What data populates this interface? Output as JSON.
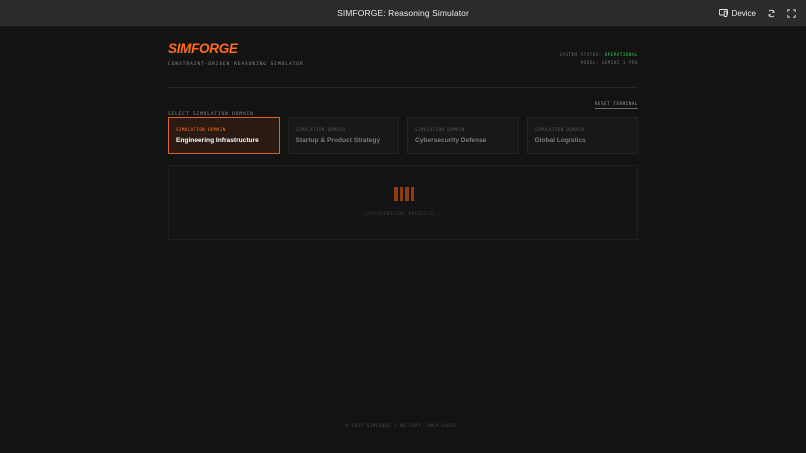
{
  "topbar": {
    "title": "SIMFORGE: Reasoning Simulator",
    "device_label": "Device",
    "icons": [
      "device-icon",
      "rotate-icon",
      "fullscreen-icon"
    ]
  },
  "header": {
    "brand": "SIMFORGE",
    "subtitle": "CONSTRAINT-DRIVEN REASONING SIMULATOR",
    "status_label": "SYSTEM STATUS:",
    "status_value": "OPERATIONAL",
    "model_label": "MODEL: GEMINI 3 PRO"
  },
  "domain_select": {
    "label": "SELECT SIMULATION DOMAIN",
    "reset_label": "RESET TERMINAL"
  },
  "cards": [
    {
      "kicker": "SIMULATION DOMAIN",
      "title": "Engineering Infrastructure",
      "active": true
    },
    {
      "kicker": "SIMULATION DOMAIN",
      "title": "Startup & Product Strategy",
      "active": false
    },
    {
      "kicker": "SIMULATION DOMAIN",
      "title": "Cybersecurity Defense",
      "active": false
    },
    {
      "kicker": "SIMULATION DOMAIN",
      "title": "Global Logistics",
      "active": false
    }
  ],
  "panel": {
    "sync_text": "SYNCHRONIZING ROLESETS..."
  },
  "footer": {
    "text": "© 2025 SIMFORGE | NO CHAT. ONLY LOGIC."
  },
  "colors": {
    "accent": "#ff6a1f",
    "status_ok": "#2ecc5a",
    "background": "#131313"
  }
}
